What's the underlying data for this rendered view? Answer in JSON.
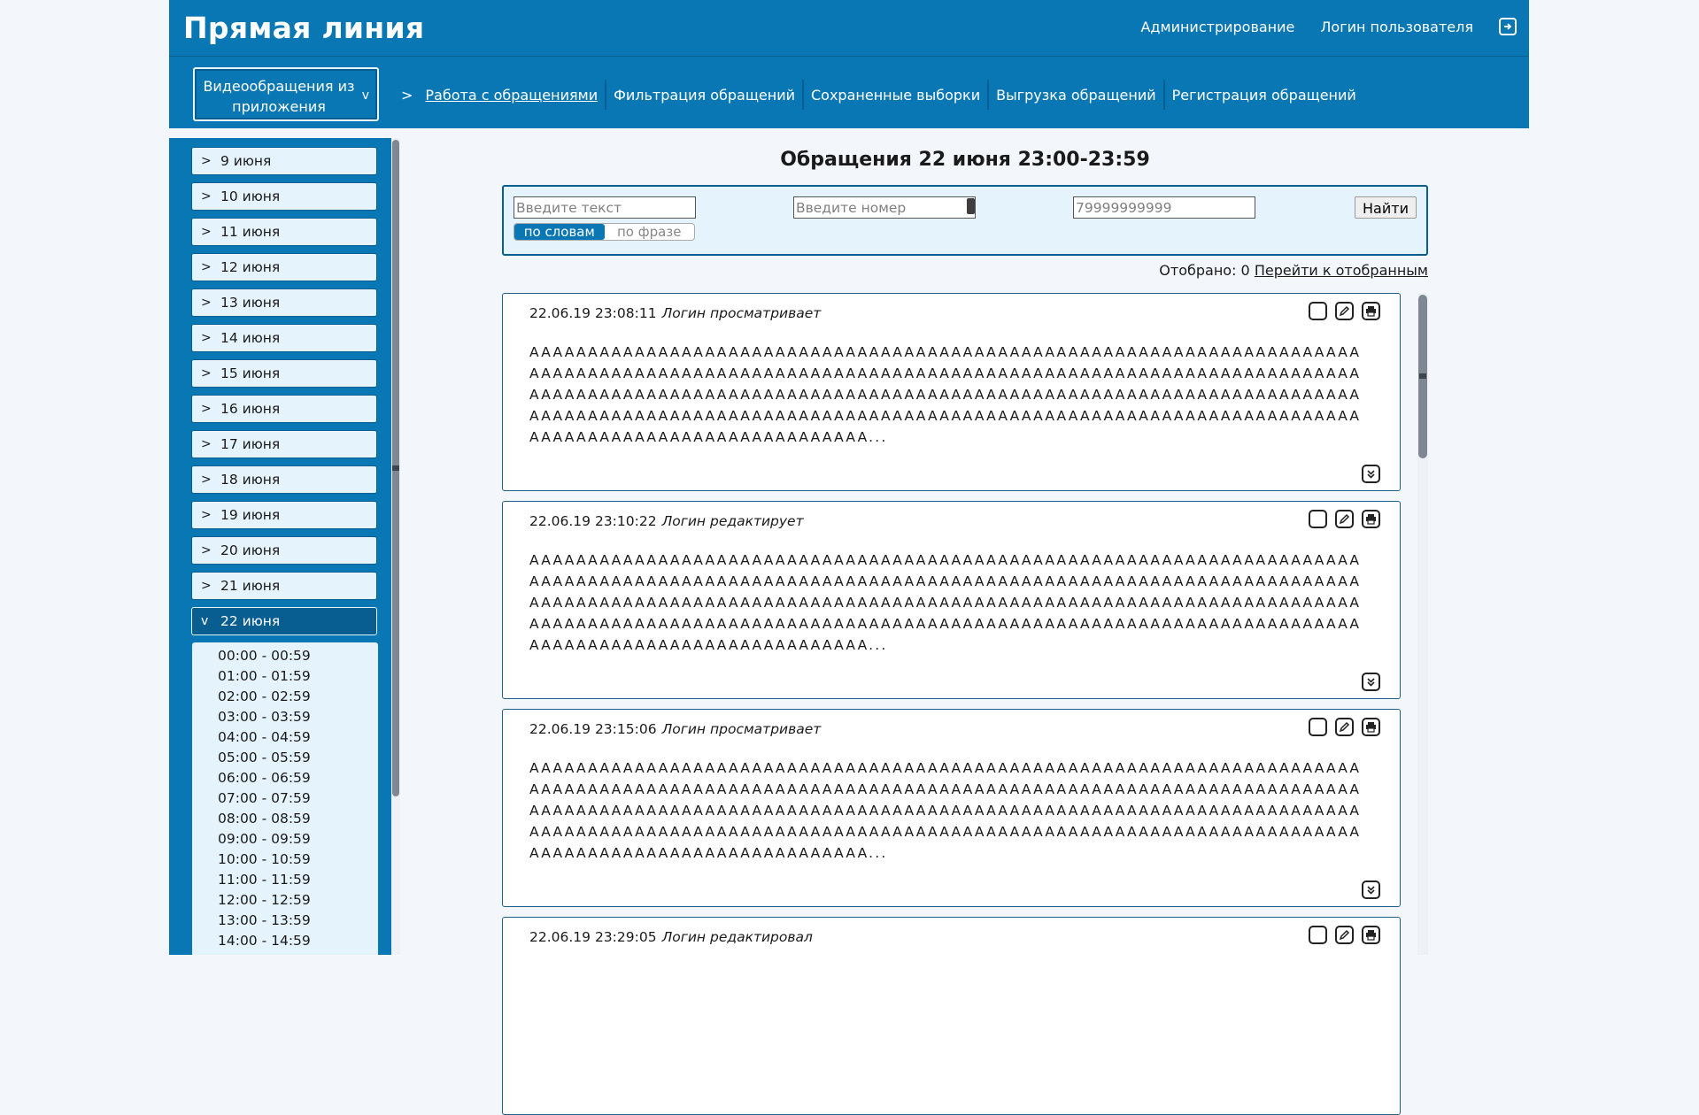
{
  "app": {
    "title": "Прямая линия"
  },
  "top_links": {
    "admin": "Администрирование",
    "user_login": "Логин пользователя",
    "logout_icon": "logout-icon"
  },
  "dropdown": {
    "label": "Видеообращения из приложения",
    "chevron": "v"
  },
  "breadcrumb_arrow": ">",
  "nav": [
    {
      "label": "Работа с обращениями",
      "active": true
    },
    {
      "label": "Фильтрация обращений"
    },
    {
      "label": "Сохраненные выборки"
    },
    {
      "label": "Выгрузка обращений"
    },
    {
      "label": "Регистрация обращений"
    }
  ],
  "sidebar": {
    "dates": [
      {
        "arrow": ">",
        "label": "9 июня"
      },
      {
        "arrow": ">",
        "label": "10 июня"
      },
      {
        "arrow": ">",
        "label": "11 июня"
      },
      {
        "arrow": ">",
        "label": "12 июня"
      },
      {
        "arrow": ">",
        "label": "13 июня"
      },
      {
        "arrow": ">",
        "label": "14 июня"
      },
      {
        "arrow": ">",
        "label": "15 июня"
      },
      {
        "arrow": ">",
        "label": "16 июня"
      },
      {
        "arrow": ">",
        "label": "17 июня"
      },
      {
        "arrow": ">",
        "label": "18 июня"
      },
      {
        "arrow": ">",
        "label": "19 июня"
      },
      {
        "arrow": ">",
        "label": "20 июня"
      },
      {
        "arrow": ">",
        "label": "21 июня"
      },
      {
        "arrow": "v",
        "label": "22 июня",
        "active": true
      }
    ],
    "times": [
      "00:00 - 00:59",
      "01:00 - 01:59",
      "02:00 - 02:59",
      "03:00 - 03:59",
      "04:00 - 04:59",
      "05:00 - 05:59",
      "06:00 - 06:59",
      "07:00 - 07:59",
      "08:00 - 08:59",
      "09:00 - 09:59",
      "10:00 - 10:59",
      "11:00 - 11:59",
      "12:00 - 12:59",
      "13:00 - 13:59",
      "14:00 - 14:59"
    ]
  },
  "main": {
    "title": "Обращения 22 июня 23:00-23:59",
    "search": {
      "text_placeholder": "Введите текст",
      "number_placeholder": "Введите номер",
      "phone_placeholder": "79999999999",
      "find_label": "Найти",
      "mode_words": "по словам",
      "mode_phrase": "по фразе"
    },
    "selected": {
      "label": "Отобрано: 0",
      "link": "Перейти к отобранным"
    },
    "cards": [
      {
        "datetime": "22.06.19 23:08:11",
        "status": "Логин просматривает",
        "lines": [
          "AAAAAAAAAAAAAAAAAAAAAAAAAAAAAAAAAAAAAAAAAAAAAAAAAAAAAAAAAAAAAAAAAAAAAAA",
          "AAAAAAAAAAAAAAAAAAAAAAAAAAAAAAAAAAAAAAAAAAAAAAAAAAAAAAAAAAAAAAAAAAAAAAA",
          "AAAAAAAAAAAAAAAAAAAAAAAAAAAAAAAAAAAAAAAAAAAAAAAAAAAAAAAAAAAAAAAAAAAAAAA",
          "AAAAAAAAAAAAAAAAAAAAAAAAAAAAAAAAAAAAAAAAAAAAAAAAAAAAAAAAAAAAAAAAAAAAAAA",
          "AAAAAAAAAAAAAAAAAAAAAAAAAAAAA..."
        ]
      },
      {
        "datetime": "22.06.19 23:10:22",
        "status": "Логин редактирует",
        "lines": [
          "AAAAAAAAAAAAAAAAAAAAAAAAAAAAAAAAAAAAAAAAAAAAAAAAAAAAAAAAAAAAAAAAAAAAAAA",
          "AAAAAAAAAAAAAAAAAAAAAAAAAAAAAAAAAAAAAAAAAAAAAAAAAAAAAAAAAAAAAAAAAAAAAAA",
          "AAAAAAAAAAAAAAAAAAAAAAAAAAAAAAAAAAAAAAAAAAAAAAAAAAAAAAAAAAAAAAAAAAAAAAA",
          "AAAAAAAAAAAAAAAAAAAAAAAAAAAAAAAAAAAAAAAAAAAAAAAAAAAAAAAAAAAAAAAAAAAAAAA",
          "AAAAAAAAAAAAAAAAAAAAAAAAAAAAA..."
        ]
      },
      {
        "datetime": "22.06.19 23:15:06",
        "status": "Логин просматривает",
        "lines": [
          "AAAAAAAAAAAAAAAAAAAAAAAAAAAAAAAAAAAAAAAAAAAAAAAAAAAAAAAAAAAAAAAAAAAAAAA",
          "AAAAAAAAAAAAAAAAAAAAAAAAAAAAAAAAAAAAAAAAAAAAAAAAAAAAAAAAAAAAAAAAAAAAAAA",
          "AAAAAAAAAAAAAAAAAAAAAAAAAAAAAAAAAAAAAAAAAAAAAAAAAAAAAAAAAAAAAAAAAAAAAAA",
          "AAAAAAAAAAAAAAAAAAAAAAAAAAAAAAAAAAAAAAAAAAAAAAAAAAAAAAAAAAAAAAAAAAAAAAA",
          "AAAAAAAAAAAAAAAAAAAAAAAAAAAAA..."
        ]
      },
      {
        "datetime": "22.06.19 23:29:05",
        "status": "Логин редактировал",
        "lines": []
      }
    ],
    "card_icons": [
      "checkbox-icon",
      "edit-icon",
      "print-icon",
      "expand-icon"
    ]
  },
  "colors": {
    "primary": "#0a77b5",
    "primary_dark": "#085e91",
    "panel": "#e4f3fc",
    "page_bg": "#f3f6fb"
  }
}
